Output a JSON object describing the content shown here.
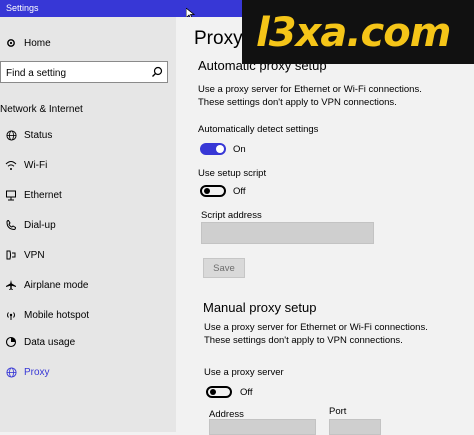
{
  "window": {
    "title": "Settings"
  },
  "watermark": {
    "text": "l3xa.com"
  },
  "sidebar": {
    "home_label": "Home",
    "search_placeholder": "Find a setting",
    "section_label": "Network & Internet",
    "items": [
      {
        "label": "Status",
        "icon": "globe-icon",
        "active": false
      },
      {
        "label": "Wi-Fi",
        "icon": "wifi-icon",
        "active": false
      },
      {
        "label": "Ethernet",
        "icon": "ethernet-icon",
        "active": false
      },
      {
        "label": "Dial-up",
        "icon": "phone-icon",
        "active": false
      },
      {
        "label": "VPN",
        "icon": "vpn-icon",
        "active": false
      },
      {
        "label": "Airplane mode",
        "icon": "airplane-icon",
        "active": false
      },
      {
        "label": "Mobile hotspot",
        "icon": "hotspot-icon",
        "active": false
      },
      {
        "label": "Data usage",
        "icon": "data-usage-icon",
        "active": false
      },
      {
        "label": "Proxy",
        "icon": "globe-icon",
        "active": true
      }
    ]
  },
  "main": {
    "title": "Proxy",
    "automatic": {
      "heading": "Automatic proxy setup",
      "description": "Use a proxy server for Ethernet or Wi-Fi connections. These settings don't apply to VPN connections.",
      "auto_detect_label": "Automatically detect settings",
      "auto_detect_state": "On",
      "setup_script_label": "Use setup script",
      "setup_script_state": "Off",
      "script_address_label": "Script address",
      "script_address_value": "",
      "save_label": "Save"
    },
    "manual": {
      "heading": "Manual proxy setup",
      "description": "Use a proxy server for Ethernet or Wi-Fi connections. These settings don't apply to VPN connections.",
      "use_proxy_label": "Use a proxy server",
      "use_proxy_state": "Off",
      "address_label": "Address",
      "address_value": "",
      "port_label": "Port",
      "port_value": ""
    }
  },
  "colors": {
    "accent": "#3737d6",
    "titlebar": "#3737d6",
    "sidebar_bg": "#e6e6e6",
    "content_bg": "#f2f2f2"
  }
}
